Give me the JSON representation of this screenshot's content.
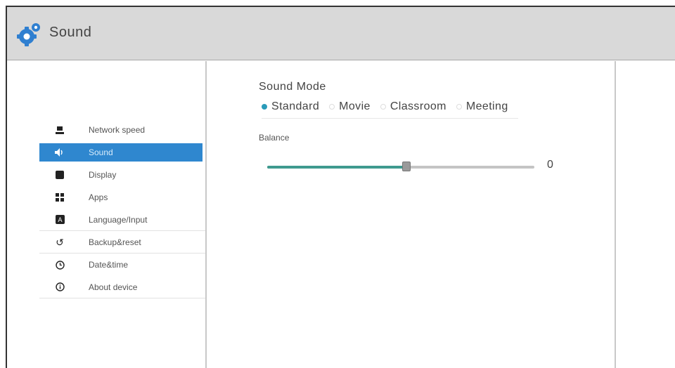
{
  "window": {
    "title": "Sound",
    "app_icon": "gear-icon",
    "colors": {
      "accent": "#2f87cf",
      "slider_fill": "#3f9a8f",
      "titlebar": "#d9d9d9"
    }
  },
  "sidebar": {
    "items": [
      {
        "label": "Network speed",
        "icon": "network-icon"
      },
      {
        "label": "Sound",
        "icon": "speaker-icon",
        "selected": true
      },
      {
        "label": "Display",
        "icon": "display-icon"
      },
      {
        "label": "Apps",
        "icon": "apps-icon"
      },
      {
        "label": "Language/Input",
        "icon": "language-icon"
      },
      {
        "label": "Backup&reset",
        "icon": "reset-icon"
      },
      {
        "label": "Date&time",
        "icon": "clock-icon"
      },
      {
        "label": "About device",
        "icon": "info-icon"
      }
    ]
  },
  "main": {
    "section_title": "Sound Mode",
    "modes": [
      {
        "label": "Standard",
        "selected": true
      },
      {
        "label": "Movie",
        "selected": false
      },
      {
        "label": "Classroom",
        "selected": false
      },
      {
        "label": "Meeting",
        "selected": false
      }
    ],
    "balance": {
      "label": "Balance",
      "value": "0",
      "position_fraction": 0.52
    }
  }
}
